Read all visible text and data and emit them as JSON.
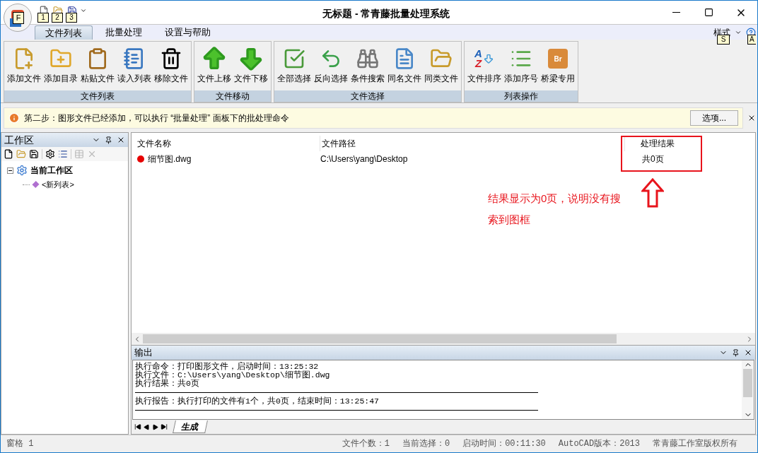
{
  "window": {
    "title": "无标题 - 常青藤批量处理系统",
    "app_keytip": "F",
    "quick_access": [
      {
        "keytip": "1"
      },
      {
        "keytip": "2"
      },
      {
        "keytip": "3"
      }
    ]
  },
  "ribbon_tabs": [
    {
      "label": "文件列表",
      "selected": true
    },
    {
      "label": "批量处理",
      "selected": false
    },
    {
      "label": "设置与帮助",
      "selected": false
    }
  ],
  "ribbon_right": {
    "style_label": "样式",
    "style_keytip": "S",
    "help_keytip": "A"
  },
  "ribbon_groups": [
    {
      "title": "文件列表",
      "buttons": [
        {
          "label": "添加文件"
        },
        {
          "label": "添加目录"
        },
        {
          "label": "粘贴文件"
        },
        {
          "label": "读入列表"
        },
        {
          "label": "移除文件"
        }
      ]
    },
    {
      "title": "文件移动",
      "buttons": [
        {
          "label": "文件上移"
        },
        {
          "label": "文件下移"
        }
      ]
    },
    {
      "title": "文件选择",
      "buttons": [
        {
          "label": "全部选择"
        },
        {
          "label": "反向选择"
        },
        {
          "label": "条件搜索"
        },
        {
          "label": "同名文件"
        },
        {
          "label": "同类文件"
        }
      ]
    },
    {
      "title": "列表操作",
      "buttons": [
        {
          "label": "文件排序",
          "glyphs": [
            "A",
            "Z"
          ]
        },
        {
          "label": "添加序号"
        },
        {
          "label": "桥梁专用",
          "glyphs": [
            "Br"
          ]
        }
      ]
    }
  ],
  "info_bar": {
    "message": "第二步：图形文件已经添加，可以执行 “批量处理” 面板下的批处理命令",
    "button": "选项..."
  },
  "workspace": {
    "title": "工作区",
    "tree": [
      {
        "label": "当前工作区",
        "expanded": true,
        "children": [
          {
            "label": "<新列表>"
          }
        ]
      }
    ]
  },
  "file_list": {
    "columns": [
      "文件名称",
      "文件路径",
      "处理结果"
    ],
    "rows": [
      {
        "color": "#e60000",
        "cells": [
          "细节图.dwg",
          "C:\\Users\\yang\\Desktop",
          "共0页"
        ]
      }
    ]
  },
  "annotation": {
    "text": "结果显示为0页，说明没有搜索到图框"
  },
  "output": {
    "title": "输出",
    "blocks": [
      [
        "执行命令：打印图形文件，启动时间：13:25:32",
        "执行文件：C:\\Users\\yang\\Desktop\\细节图.dwg",
        "执行结果：共0页"
      ],
      [
        "执行报告：执行打印的文件有1个，共0页，结束时间：13:25:47"
      ]
    ],
    "tabs": [
      {
        "label": "生成",
        "selected": true
      }
    ]
  },
  "status_bar": {
    "left": "窗格 1",
    "items": [
      "文件个数：1",
      "当前选择：0",
      "启动时间：00:11:30",
      "AutoCAD版本：2013",
      "常青藤工作室版权所有"
    ]
  }
}
